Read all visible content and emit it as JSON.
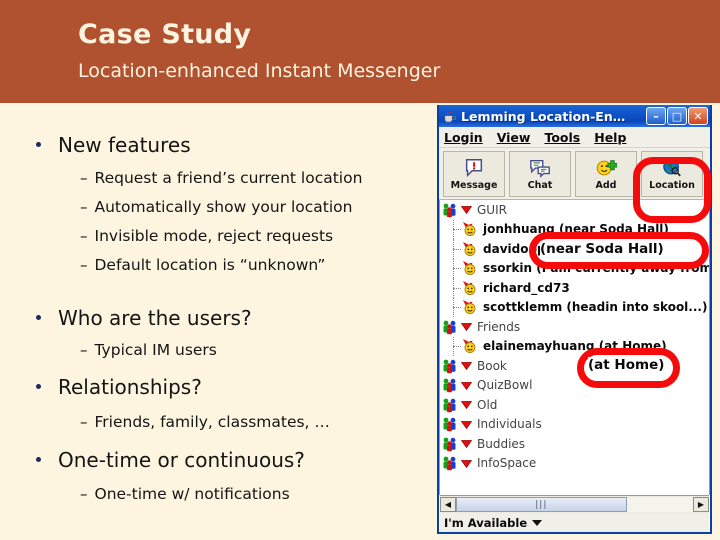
{
  "slide": {
    "title": "Case Study",
    "subtitle": "Location-enhanced Instant Messenger",
    "header_color": "#b0512f",
    "body_color": "#fdf5e0",
    "bullets": [
      {
        "text": "New features",
        "sub": [
          "Request a friend’s current location",
          "Automatically show your location",
          "Invisible mode, reject requests",
          "Default location is “unknown”"
        ]
      },
      {
        "text": "Who are the users?",
        "sub": [
          "Typical IM users"
        ]
      },
      {
        "text": "Relationships?",
        "sub": [
          "Friends, family, classmates, …"
        ]
      },
      {
        "text": "One-time or continuous?",
        "sub": [
          "One-time w/ notifications"
        ]
      }
    ]
  },
  "im_window": {
    "title": "Lemming Location-En…",
    "window_buttons": {
      "minimize": "–",
      "maximize": "□",
      "close": "✕"
    },
    "menu": [
      "Login",
      "View",
      "Tools",
      "Help"
    ],
    "toolbar": [
      {
        "label": "Message",
        "icon": "message-bubble-icon"
      },
      {
        "label": "Chat",
        "icon": "chat-bubbles-icon"
      },
      {
        "label": "Add",
        "icon": "add-buddy-icon"
      },
      {
        "label": "Location",
        "icon": "globe-location-icon"
      }
    ],
    "buddy_list": [
      {
        "type": "group",
        "label": "GUIR"
      },
      {
        "type": "buddy",
        "label": "jonhhuang (near Soda Hall)"
      },
      {
        "type": "buddy",
        "label": "davidopp123"
      },
      {
        "type": "buddy",
        "label": "ssorkin (I am currently away from th"
      },
      {
        "type": "buddy",
        "label": "richard_cd73"
      },
      {
        "type": "buddy",
        "label": "scottklemm (headin into skool...)"
      },
      {
        "type": "group",
        "label": "Friends"
      },
      {
        "type": "buddy",
        "label": "elainemayhuang (at Home)"
      },
      {
        "type": "group",
        "label": "Book"
      },
      {
        "type": "group",
        "label": "QuizBowl"
      },
      {
        "type": "group",
        "label": "Old"
      },
      {
        "type": "group",
        "label": "Individuals"
      },
      {
        "type": "group",
        "label": "Buddies"
      },
      {
        "type": "group",
        "label": "InfoSpace"
      }
    ],
    "scrollbar": {
      "left_arrow": "◀",
      "right_arrow": "▶",
      "grip": "⫿e"
    },
    "status": {
      "text": "I'm Available",
      "caret": "caret-down-icon"
    }
  },
  "annotations": {
    "highlight_color": "#f50b0b",
    "items": [
      {
        "name": "location-button-highlight",
        "label": ""
      },
      {
        "name": "near-soda-hall-highlight",
        "label": "(near Soda Hall)"
      },
      {
        "name": "at-home-highlight",
        "label": "(at Home)"
      }
    ]
  }
}
